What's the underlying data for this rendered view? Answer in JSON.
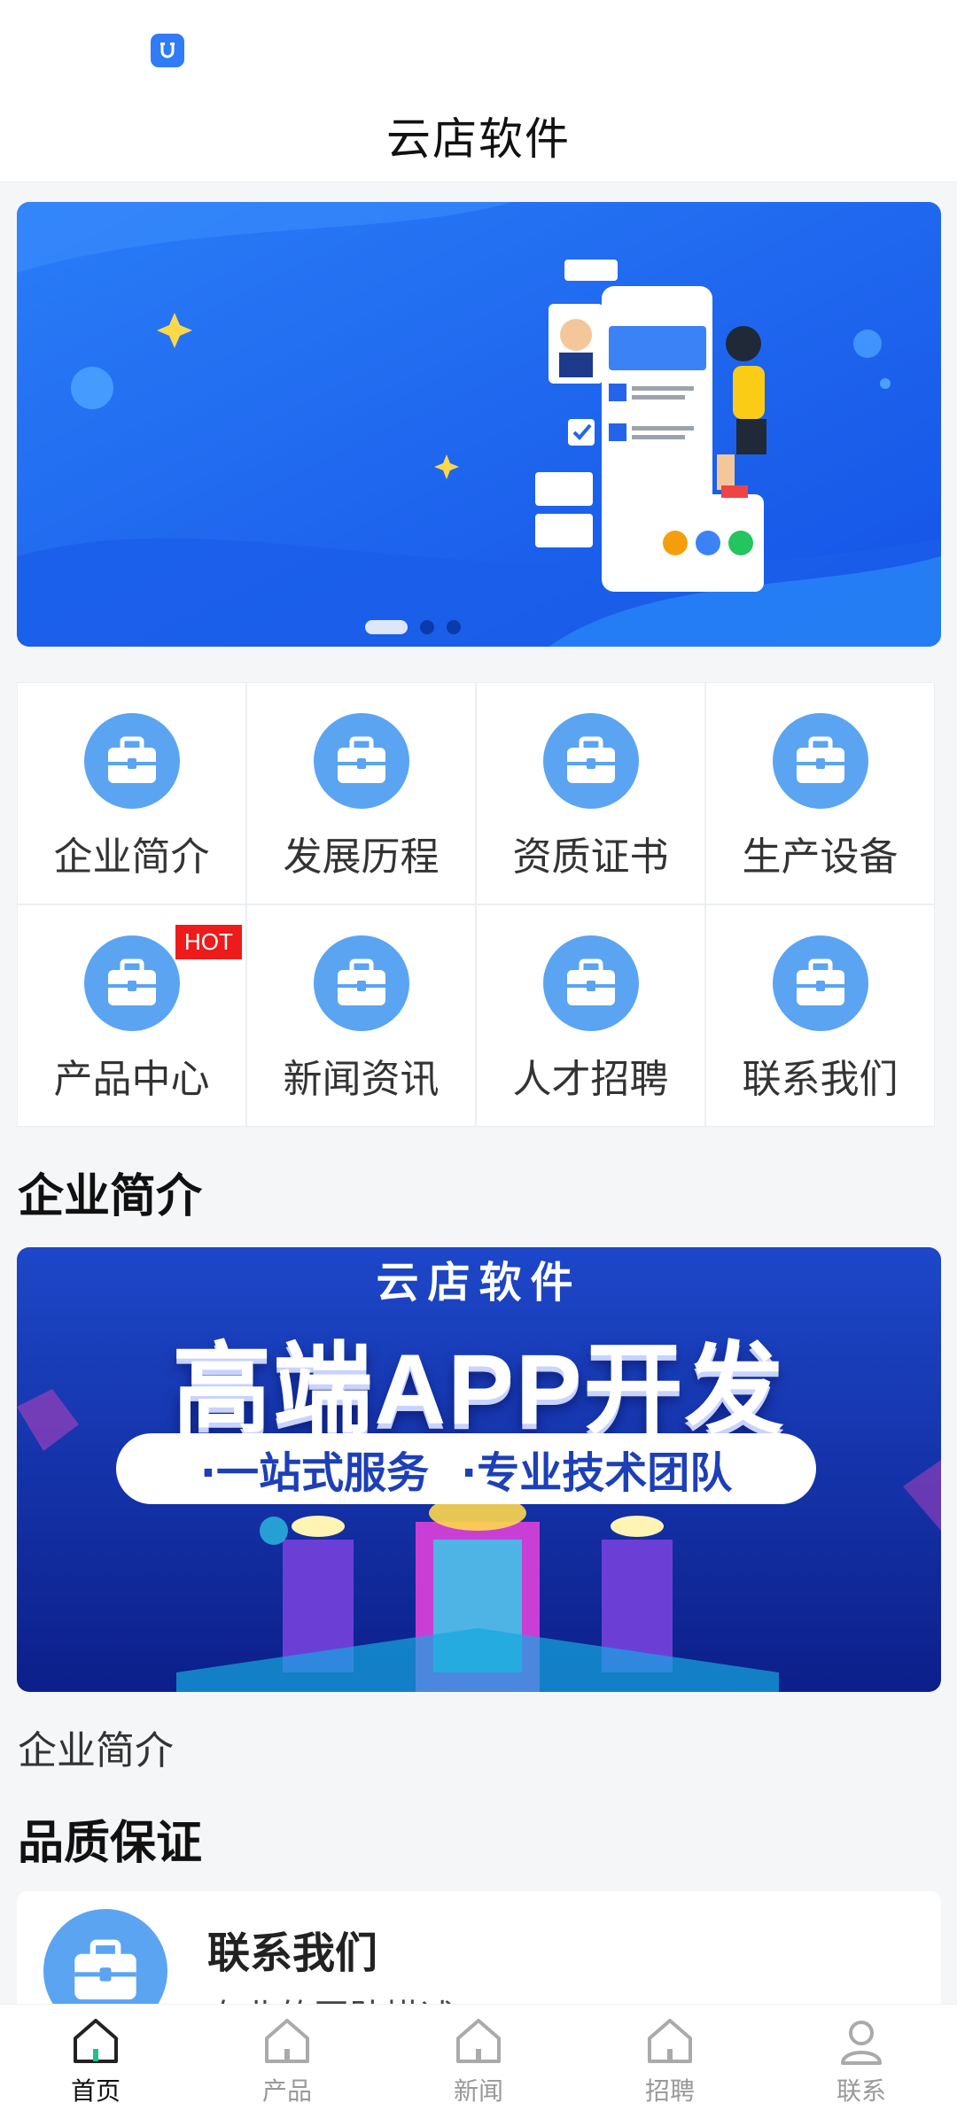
{
  "header": {
    "title": "云店软件"
  },
  "banner": {
    "slides": 3,
    "active_slide": 0
  },
  "grid": {
    "items": [
      {
        "label": "企业简介",
        "icon": "briefcase-icon"
      },
      {
        "label": "发展历程",
        "icon": "briefcase-icon"
      },
      {
        "label": "资质证书",
        "icon": "briefcase-icon"
      },
      {
        "label": "生产设备",
        "icon": "briefcase-icon"
      },
      {
        "label": "产品中心",
        "icon": "briefcase-icon",
        "badge": "HOT"
      },
      {
        "label": "新闻资讯",
        "icon": "briefcase-icon"
      },
      {
        "label": "人才招聘",
        "icon": "briefcase-icon"
      },
      {
        "label": "联系我们",
        "icon": "briefcase-icon"
      }
    ]
  },
  "intro": {
    "title": "企业简介",
    "promo_subtitle": "云店软件",
    "promo_title": "高端APP开发",
    "promo_tag_1": "·一站式服务",
    "promo_tag_2": "·专业技术团队",
    "text": "企业简介"
  },
  "quality": {
    "title": "品质保证",
    "card_title": "联系我们",
    "card_desc": "专业的团队描述"
  },
  "tabbar": {
    "active": 0,
    "tabs": [
      {
        "label": "首页",
        "icon": "home-icon"
      },
      {
        "label": "产品",
        "icon": "home-icon"
      },
      {
        "label": "新闻",
        "icon": "home-icon"
      },
      {
        "label": "招聘",
        "icon": "home-icon"
      },
      {
        "label": "联系",
        "icon": "user-icon"
      }
    ]
  },
  "colors": {
    "accent": "#5aa4f2",
    "hot": "#ee1b1b",
    "banner_blue": "#1a5ff0"
  }
}
